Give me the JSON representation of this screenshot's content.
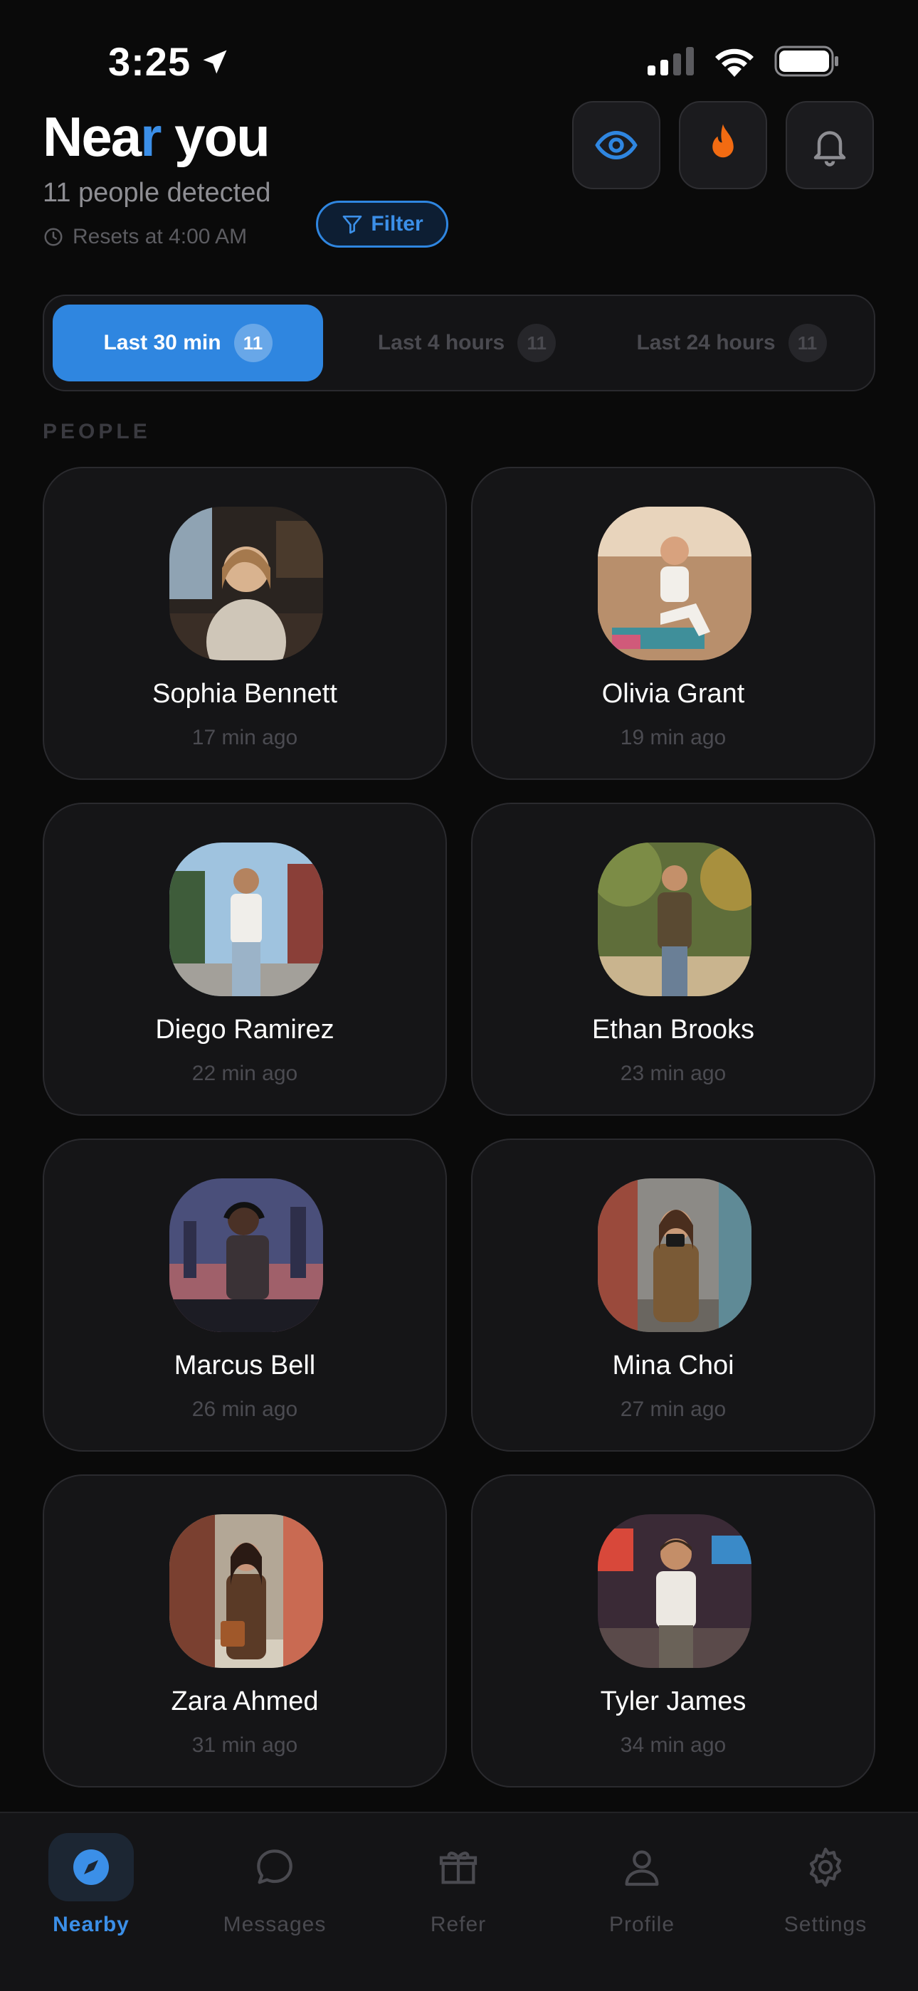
{
  "status_bar": {
    "time": "3:25"
  },
  "header": {
    "title_part1": "Nea",
    "title_accent": "r",
    "title_part2": " you",
    "subtitle": "11 people detected",
    "resets": "Resets at 4:00 AM",
    "filter_label": "Filter"
  },
  "colors": {
    "accent": "#2f86e0",
    "flame": "#f26b12",
    "background": "#0a0a0a",
    "card": "#151517"
  },
  "segments": [
    {
      "label": "Last 30 min",
      "count": "11",
      "active": true
    },
    {
      "label": "Last 4 hours",
      "count": "11",
      "active": false
    },
    {
      "label": "Last 24 hours",
      "count": "11",
      "active": false
    }
  ],
  "section_label": "PEOPLE",
  "people": [
    {
      "name": "Sophia Bennett",
      "time": "17 min ago",
      "photo": "cafe-portrait"
    },
    {
      "name": "Olivia Grant",
      "time": "19 min ago",
      "photo": "beach-yoga"
    },
    {
      "name": "Diego Ramirez",
      "time": "22 min ago",
      "photo": "street-walk"
    },
    {
      "name": "Ethan Brooks",
      "time": "23 min ago",
      "photo": "park-path"
    },
    {
      "name": "Marcus Bell",
      "time": "26 min ago",
      "photo": "dj-city-night"
    },
    {
      "name": "Mina Choi",
      "time": "27 min ago",
      "photo": "camera-street"
    },
    {
      "name": "Zara Ahmed",
      "time": "31 min ago",
      "photo": "alley-portrait"
    },
    {
      "name": "Tyler James",
      "time": "34 min ago",
      "photo": "neon-street"
    }
  ],
  "tabs": [
    {
      "label": "Nearby",
      "icon": "compass-icon",
      "active": true
    },
    {
      "label": "Messages",
      "icon": "chat-bubble-icon",
      "active": false
    },
    {
      "label": "Refer",
      "icon": "gift-icon",
      "active": false
    },
    {
      "label": "Profile",
      "icon": "person-icon",
      "active": false
    },
    {
      "label": "Settings",
      "icon": "gear-icon",
      "active": false
    }
  ]
}
